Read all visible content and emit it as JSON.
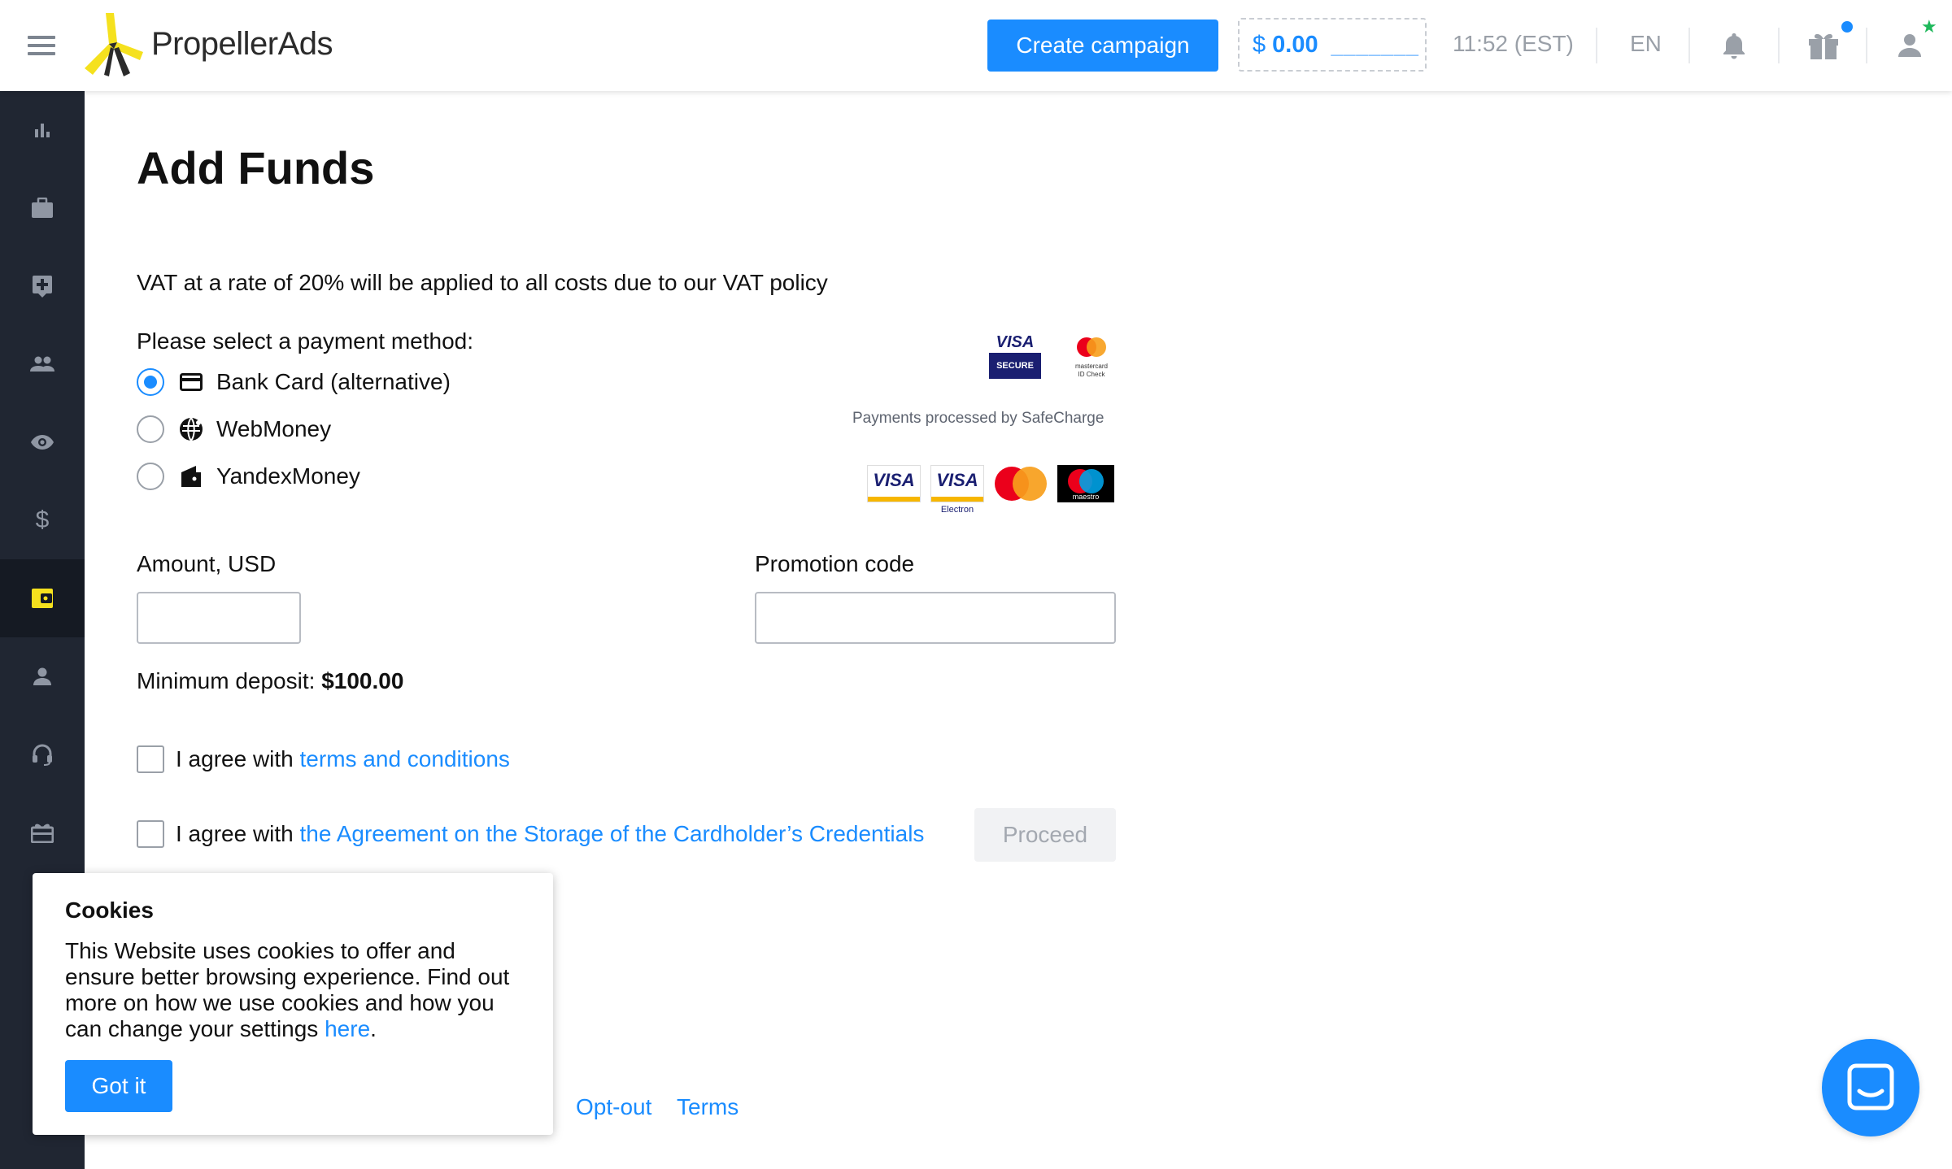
{
  "header": {
    "logo_text": "PropellerAds",
    "create_campaign": "Create campaign",
    "balance_currency": "$",
    "balance_amount": "0.00",
    "balance_placeholder": "_______",
    "time": "11:52 (EST)",
    "language": "EN",
    "icons": [
      "menu-icon",
      "bell-icon",
      "gift-icon",
      "user-icon"
    ]
  },
  "sidebar": {
    "items": [
      {
        "icon": "bar-chart-icon"
      },
      {
        "icon": "briefcase-icon"
      },
      {
        "icon": "plus-box-icon"
      },
      {
        "icon": "people-icon"
      },
      {
        "icon": "eye-icon"
      },
      {
        "icon": "dollar-icon"
      },
      {
        "icon": "wallet-icon",
        "active": true
      },
      {
        "icon": "person-icon"
      },
      {
        "icon": "headset-icon"
      },
      {
        "icon": "gift-card-icon"
      }
    ]
  },
  "main": {
    "title": "Add Funds",
    "vat_notice": "VAT at a rate of 20% will be applied to all costs due to our VAT policy",
    "payment_label": "Please select a payment method:",
    "payment_methods": [
      {
        "label": "Bank Card (alternative)",
        "icon": "credit-card-icon",
        "selected": true
      },
      {
        "label": "WebMoney",
        "icon": "webmoney-icon",
        "selected": false
      },
      {
        "label": "YandexMoney",
        "icon": "yandex-money-icon",
        "selected": false
      }
    ],
    "processed_by": "Payments processed by SafeCharge",
    "badges": {
      "visa_secure_top": "VISA",
      "visa_secure_bottom": "SECURE",
      "mc_idcheck_line1": "mastercard",
      "mc_idcheck_line2": "ID Check",
      "visa": "VISA",
      "visa_electron": "VISA",
      "electron": "Electron",
      "maestro": "maestro"
    },
    "amount_label": "Amount, USD",
    "amount_value": "",
    "promo_label": "Promotion code",
    "promo_value": "",
    "min_deposit_label": "Minimum deposit:",
    "min_deposit_value": "$100.00",
    "agree_prefix": "I agree with",
    "terms_link": "terms and conditions",
    "agreement_link": "the Agreement on the Storage of the Cardholder’s Credentials",
    "proceed": "Proceed",
    "footer": {
      "opt_out": "Opt-out",
      "terms": "Terms"
    }
  },
  "cookie": {
    "title": "Cookies",
    "text": "This Website uses cookies to offer and ensure better browsing experience. Find out more on how we use cookies and how you can change your settings ",
    "link": "here",
    "suffix": ".",
    "button": "Got it"
  },
  "colors": {
    "accent": "#1a8cff",
    "sidebar": "#202632",
    "logo_yellow": "#f5e11e"
  }
}
